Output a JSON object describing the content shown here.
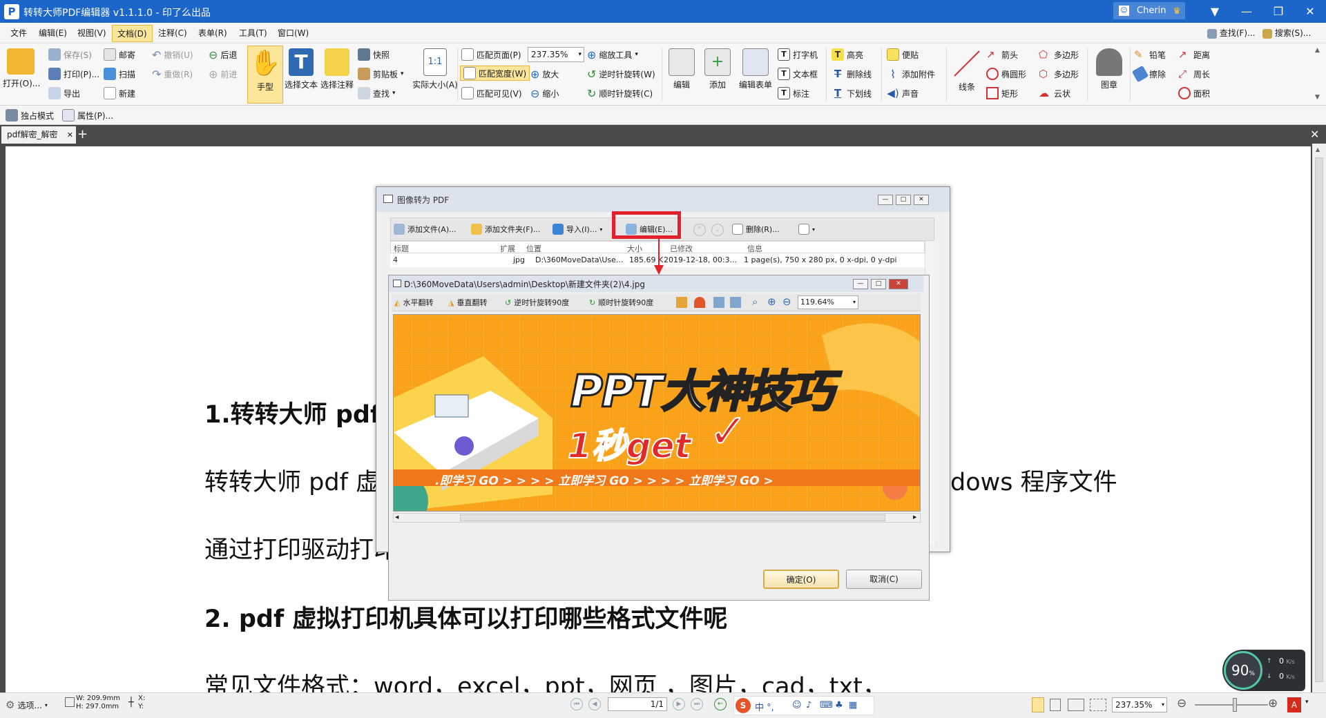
{
  "titlebar": {
    "app_title": "转转大师PDF编辑器 v1.1.1.0 - 印了么出品",
    "app_icon_letter": "P",
    "username": "Cherin",
    "controls": [
      "▼",
      "—",
      "❐",
      "✕"
    ]
  },
  "menubar": {
    "items": [
      "文件",
      "编辑(E)",
      "视图(V)",
      "文档(D)",
      "注释(C)",
      "表单(R)",
      "工具(T)",
      "窗口(W)"
    ],
    "active": "文档(D)",
    "right": [
      "查找(F)...",
      "搜索(S)..."
    ]
  },
  "ribbon": {
    "open": "打开(O)...",
    "file_group": [
      "保存(S)",
      "打印(P)...",
      "导出",
      "邮寄",
      "扫描",
      "新建",
      "撤销(U)",
      "重做(R)",
      "后退",
      "前进"
    ],
    "hand": "手型",
    "select_text": "选择文本",
    "select_annot": "选择注释",
    "clip_group": [
      "快照",
      "剪贴板",
      "查找"
    ],
    "actual_size": "实际大小(A)",
    "fit_group": [
      "匹配页面(P)",
      "匹配宽度(W)",
      "匹配可见(V)"
    ],
    "zoom_value": "237.35%",
    "zoom_group": [
      "缩放工具",
      "放大",
      "缩小"
    ],
    "rotate_group": [
      "逆时针旋转(W)",
      "顺时针旋转(C)"
    ],
    "edit": "编辑",
    "add": "添加",
    "edit_form": "编辑表单",
    "type_group": [
      "打字机",
      "文本框",
      "标注"
    ],
    "mark_group": [
      "高亮",
      "删除线",
      "下划线"
    ],
    "note_group": [
      "便贴",
      "添加附件",
      "声音"
    ],
    "line": "线条",
    "shape_group_a": [
      "箭头",
      "椭圆形",
      "矩形"
    ],
    "shape_group_b": [
      "多边形",
      "多边形",
      "云状"
    ],
    "stamp": "图章",
    "pencil_group": [
      "铅笔",
      "擦除"
    ],
    "measure_group": [
      "距离",
      "周长",
      "面积"
    ]
  },
  "toolbar2": [
    "独占模式",
    "属性(P)..."
  ],
  "tabs": [
    {
      "label": "pdf解密_解密"
    }
  ],
  "document": {
    "heading1": "1.转转大师 pdf",
    "para1_left": "转转大师 pdf 虚",
    "para1_right": "dows 程序文件",
    "para2_left": "通过打印驱动打印",
    "heading2": "2.  pdf 虚拟打印机具体可以打印哪些格式文件呢",
    "para3": "常见文件格式：word，excel，ppt，网页 ，图片，cad，txt，"
  },
  "dialog_outer": {
    "title": "图像转为 PDF",
    "toolbar": [
      "添加文件(A)...",
      "添加文件夹(F)...",
      "导入(I)...",
      "编辑(E)...",
      "删除(R)..."
    ],
    "columns": [
      "标题",
      "扩展",
      "位置",
      "大小",
      "已修改",
      "信息"
    ],
    "rows": [
      [
        "4",
        "jpg",
        "D:\\360MoveData\\Use...",
        "185.69 K",
        "2019-12-18, 00:3...",
        "1 page(s), 750 x 280 px, 0 x-dpi, 0 y-dpi"
      ]
    ]
  },
  "dialog_inner": {
    "title": "D:\\360MoveData\\Users\\admin\\Desktop\\新建文件夹(2)\\4.jpg",
    "toolbar": [
      "水平翻转",
      "垂直翻转",
      "逆时针旋转90度",
      "顺时针旋转90度"
    ],
    "zoom_value": "119.64%",
    "banner_title": "PPT大神技巧",
    "banner_sub": "1秒get",
    "banner_check": "✓",
    "banner_ticker": ".即学习  GO > > > > 立即学习  GO > > > > 立即学习  GO >",
    "ok": "确定(O)",
    "cancel": "取消(C)"
  },
  "statusbar": {
    "options": "选项...",
    "width": "W: 209.9mm",
    "height": "H: 297.0mm",
    "x": "X:",
    "y": "Y:",
    "page": "1/1",
    "zoom": "237.35%",
    "ime": "中 °,"
  },
  "network_widget": {
    "percent": "90",
    "unit": "%",
    "up": "0",
    "down": "0",
    "speed_unit": "K/s"
  },
  "colors": {
    "titlebar": "#1c66c9",
    "highlight": "#fde69a",
    "annotation_red": "#e1212b",
    "banner_orange": "#f9a21a"
  }
}
